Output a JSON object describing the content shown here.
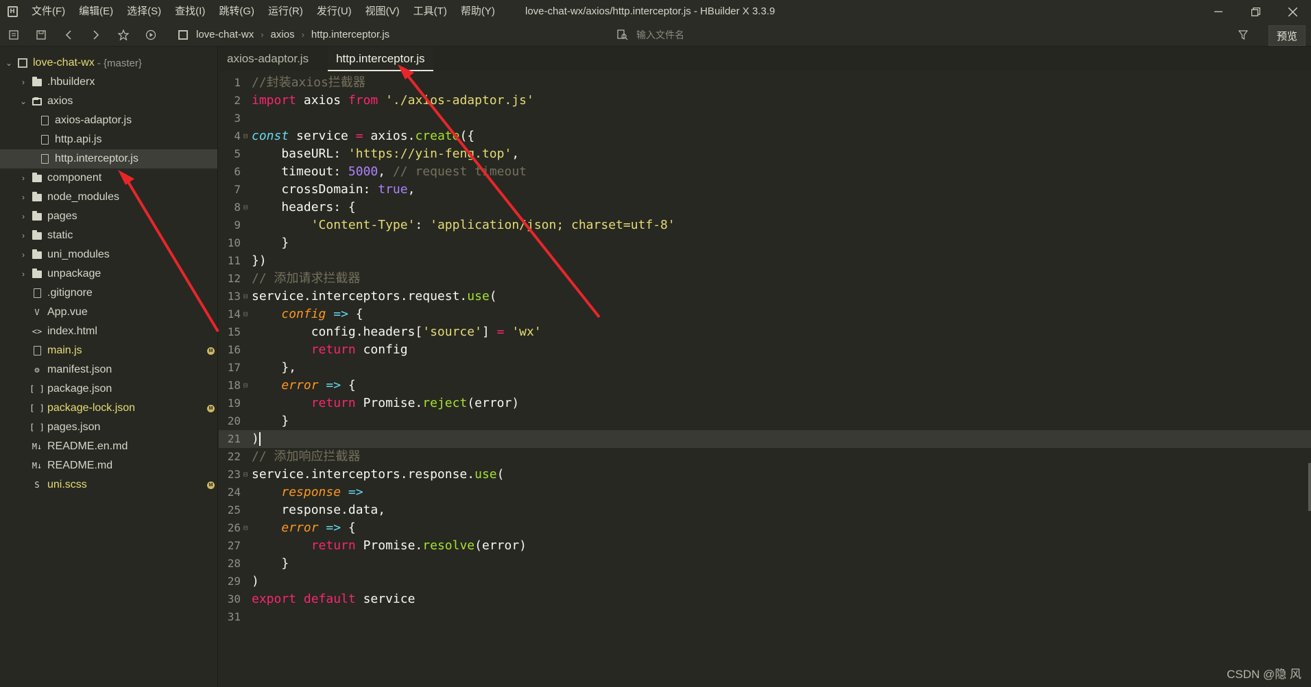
{
  "menu": [
    "文件(F)",
    "编辑(E)",
    "选择(S)",
    "查找(I)",
    "跳转(G)",
    "运行(R)",
    "发行(U)",
    "视图(V)",
    "工具(T)",
    "帮助(Y)"
  ],
  "window_title": "love-chat-wx/axios/http.interceptor.js - HBuilder X 3.3.9",
  "toolbar": {
    "breadcrumbs": [
      "love-chat-wx",
      "axios",
      "http.interceptor.js"
    ],
    "file_search_placeholder": "输入文件名",
    "preview_label": "预览"
  },
  "sidebar": {
    "project": {
      "name": "love-chat-wx",
      "branch": "- {master}"
    },
    "items": [
      {
        "label": ".hbuilderx",
        "type": "folder"
      },
      {
        "label": "axios",
        "type": "folder-open"
      },
      {
        "label": "axios-adaptor.js",
        "type": "file"
      },
      {
        "label": "http.api.js",
        "type": "file"
      },
      {
        "label": "http.interceptor.js",
        "type": "file",
        "selected": true
      },
      {
        "label": "component",
        "type": "folder"
      },
      {
        "label": "node_modules",
        "type": "folder"
      },
      {
        "label": "pages",
        "type": "folder"
      },
      {
        "label": "static",
        "type": "folder"
      },
      {
        "label": "uni_modules",
        "type": "folder"
      },
      {
        "label": "unpackage",
        "type": "folder"
      },
      {
        "label": ".gitignore",
        "type": "file"
      },
      {
        "label": "App.vue",
        "type": "vue"
      },
      {
        "label": "index.html",
        "type": "html"
      },
      {
        "label": "main.js",
        "type": "file",
        "modified": true
      },
      {
        "label": "manifest.json",
        "type": "manifest"
      },
      {
        "label": "package.json",
        "type": "json"
      },
      {
        "label": "package-lock.json",
        "type": "json",
        "modified": true
      },
      {
        "label": "pages.json",
        "type": "json"
      },
      {
        "label": "README.en.md",
        "type": "md"
      },
      {
        "label": "README.md",
        "type": "md"
      },
      {
        "label": "uni.scss",
        "type": "scss",
        "modified": true
      }
    ]
  },
  "tabs": [
    {
      "label": "axios-adaptor.js",
      "active": false
    },
    {
      "label": "http.interceptor.js",
      "active": true
    }
  ],
  "editor": {
    "current_line": 21,
    "lines": [
      {
        "n": "1",
        "fold": "",
        "tokens": [
          [
            "comment",
            "//封装axios拦截器"
          ]
        ]
      },
      {
        "n": "2",
        "fold": "",
        "tokens": [
          [
            "keyword",
            "import"
          ],
          [
            "plain",
            " axios "
          ],
          [
            "keyword",
            "from"
          ],
          [
            "plain",
            " "
          ],
          [
            "string",
            "'./axios-adaptor.js'"
          ]
        ]
      },
      {
        "n": "3",
        "fold": "",
        "tokens": []
      },
      {
        "n": "4",
        "fold": "⊟",
        "tokens": [
          [
            "keyword-i",
            "const"
          ],
          [
            "plain",
            " service "
          ],
          [
            "keyword",
            "="
          ],
          [
            "plain",
            " axios."
          ],
          [
            "func",
            "create"
          ],
          [
            "plain",
            "({"
          ]
        ]
      },
      {
        "n": "5",
        "fold": "",
        "tokens": [
          [
            "plain",
            "    baseURL: "
          ],
          [
            "string",
            "'https://yin-feng.top'"
          ],
          [
            "plain",
            ","
          ]
        ]
      },
      {
        "n": "6",
        "fold": "",
        "tokens": [
          [
            "plain",
            "    timeout: "
          ],
          [
            "number",
            "5000"
          ],
          [
            "plain",
            ", "
          ],
          [
            "comment",
            "// request timeout"
          ]
        ]
      },
      {
        "n": "7",
        "fold": "",
        "tokens": [
          [
            "plain",
            "    crossDomain: "
          ],
          [
            "bool",
            "true"
          ],
          [
            "plain",
            ","
          ]
        ]
      },
      {
        "n": "8",
        "fold": "⊟",
        "tokens": [
          [
            "plain",
            "    headers: {"
          ]
        ]
      },
      {
        "n": "9",
        "fold": "",
        "tokens": [
          [
            "plain",
            "        "
          ],
          [
            "string",
            "'Content-Type'"
          ],
          [
            "plain",
            ": "
          ],
          [
            "string",
            "'application/json; charset=utf-8'"
          ]
        ]
      },
      {
        "n": "10",
        "fold": "",
        "tokens": [
          [
            "plain",
            "    }"
          ]
        ]
      },
      {
        "n": "11",
        "fold": "",
        "tokens": [
          [
            "plain",
            "})"
          ]
        ]
      },
      {
        "n": "12",
        "fold": "",
        "tokens": [
          [
            "comment",
            "// 添加请求拦截器"
          ]
        ]
      },
      {
        "n": "13",
        "fold": "⊟",
        "tokens": [
          [
            "plain",
            "service.interceptors.request."
          ],
          [
            "func",
            "use"
          ],
          [
            "plain",
            "("
          ]
        ]
      },
      {
        "n": "14",
        "fold": "⊟",
        "tokens": [
          [
            "plain",
            "    "
          ],
          [
            "param",
            "config"
          ],
          [
            "plain",
            " "
          ],
          [
            "op",
            "=>"
          ],
          [
            "plain",
            " {"
          ]
        ]
      },
      {
        "n": "15",
        "fold": "",
        "tokens": [
          [
            "plain",
            "        config.headers["
          ],
          [
            "string",
            "'source'"
          ],
          [
            "plain",
            "] "
          ],
          [
            "keyword",
            "="
          ],
          [
            "plain",
            " "
          ],
          [
            "string",
            "'wx'"
          ]
        ]
      },
      {
        "n": "16",
        "fold": "",
        "tokens": [
          [
            "plain",
            "        "
          ],
          [
            "keyword",
            "return"
          ],
          [
            "plain",
            " config"
          ]
        ]
      },
      {
        "n": "17",
        "fold": "",
        "tokens": [
          [
            "plain",
            "    },"
          ]
        ]
      },
      {
        "n": "18",
        "fold": "⊟",
        "tokens": [
          [
            "plain",
            "    "
          ],
          [
            "param",
            "error"
          ],
          [
            "plain",
            " "
          ],
          [
            "op",
            "=>"
          ],
          [
            "plain",
            " {"
          ]
        ]
      },
      {
        "n": "19",
        "fold": "",
        "tokens": [
          [
            "plain",
            "        "
          ],
          [
            "keyword",
            "return"
          ],
          [
            "plain",
            " Promise."
          ],
          [
            "func",
            "reject"
          ],
          [
            "plain",
            "(error)"
          ]
        ]
      },
      {
        "n": "20",
        "fold": "",
        "tokens": [
          [
            "plain",
            "    }"
          ]
        ]
      },
      {
        "n": "21",
        "fold": "",
        "tokens": [
          [
            "plain",
            ")"
          ]
        ]
      },
      {
        "n": "22",
        "fold": "",
        "tokens": [
          [
            "comment",
            "// 添加响应拦截器"
          ]
        ]
      },
      {
        "n": "23",
        "fold": "⊟",
        "tokens": [
          [
            "plain",
            "service.interceptors.response."
          ],
          [
            "func",
            "use"
          ],
          [
            "plain",
            "("
          ]
        ]
      },
      {
        "n": "24",
        "fold": "",
        "tokens": [
          [
            "plain",
            "    "
          ],
          [
            "param",
            "response"
          ],
          [
            "plain",
            " "
          ],
          [
            "op",
            "=>"
          ]
        ]
      },
      {
        "n": "25",
        "fold": "",
        "tokens": [
          [
            "plain",
            "    response.data,"
          ]
        ]
      },
      {
        "n": "26",
        "fold": "⊟",
        "tokens": [
          [
            "plain",
            "    "
          ],
          [
            "param",
            "error"
          ],
          [
            "plain",
            " "
          ],
          [
            "op",
            "=>"
          ],
          [
            "plain",
            " {"
          ]
        ]
      },
      {
        "n": "27",
        "fold": "",
        "tokens": [
          [
            "plain",
            "        "
          ],
          [
            "keyword",
            "return"
          ],
          [
            "plain",
            " Promise."
          ],
          [
            "func",
            "resolve"
          ],
          [
            "plain",
            "(error)"
          ]
        ]
      },
      {
        "n": "28",
        "fold": "",
        "tokens": [
          [
            "plain",
            "    }"
          ]
        ]
      },
      {
        "n": "29",
        "fold": "",
        "tokens": [
          [
            "plain",
            ")"
          ]
        ]
      },
      {
        "n": "30",
        "fold": "",
        "tokens": [
          [
            "keyword",
            "export"
          ],
          [
            "plain",
            " "
          ],
          [
            "keyword",
            "default"
          ],
          [
            "plain",
            " service"
          ]
        ]
      },
      {
        "n": "31",
        "fold": "",
        "tokens": []
      }
    ]
  },
  "watermark": "CSDN @隐 风",
  "colors": {
    "background": "#272822",
    "arrow": "#e8262a",
    "comment": "#75715e",
    "keyword": "#f92672",
    "string": "#e6db74",
    "function": "#a6e22e",
    "number": "#ae81ff"
  }
}
